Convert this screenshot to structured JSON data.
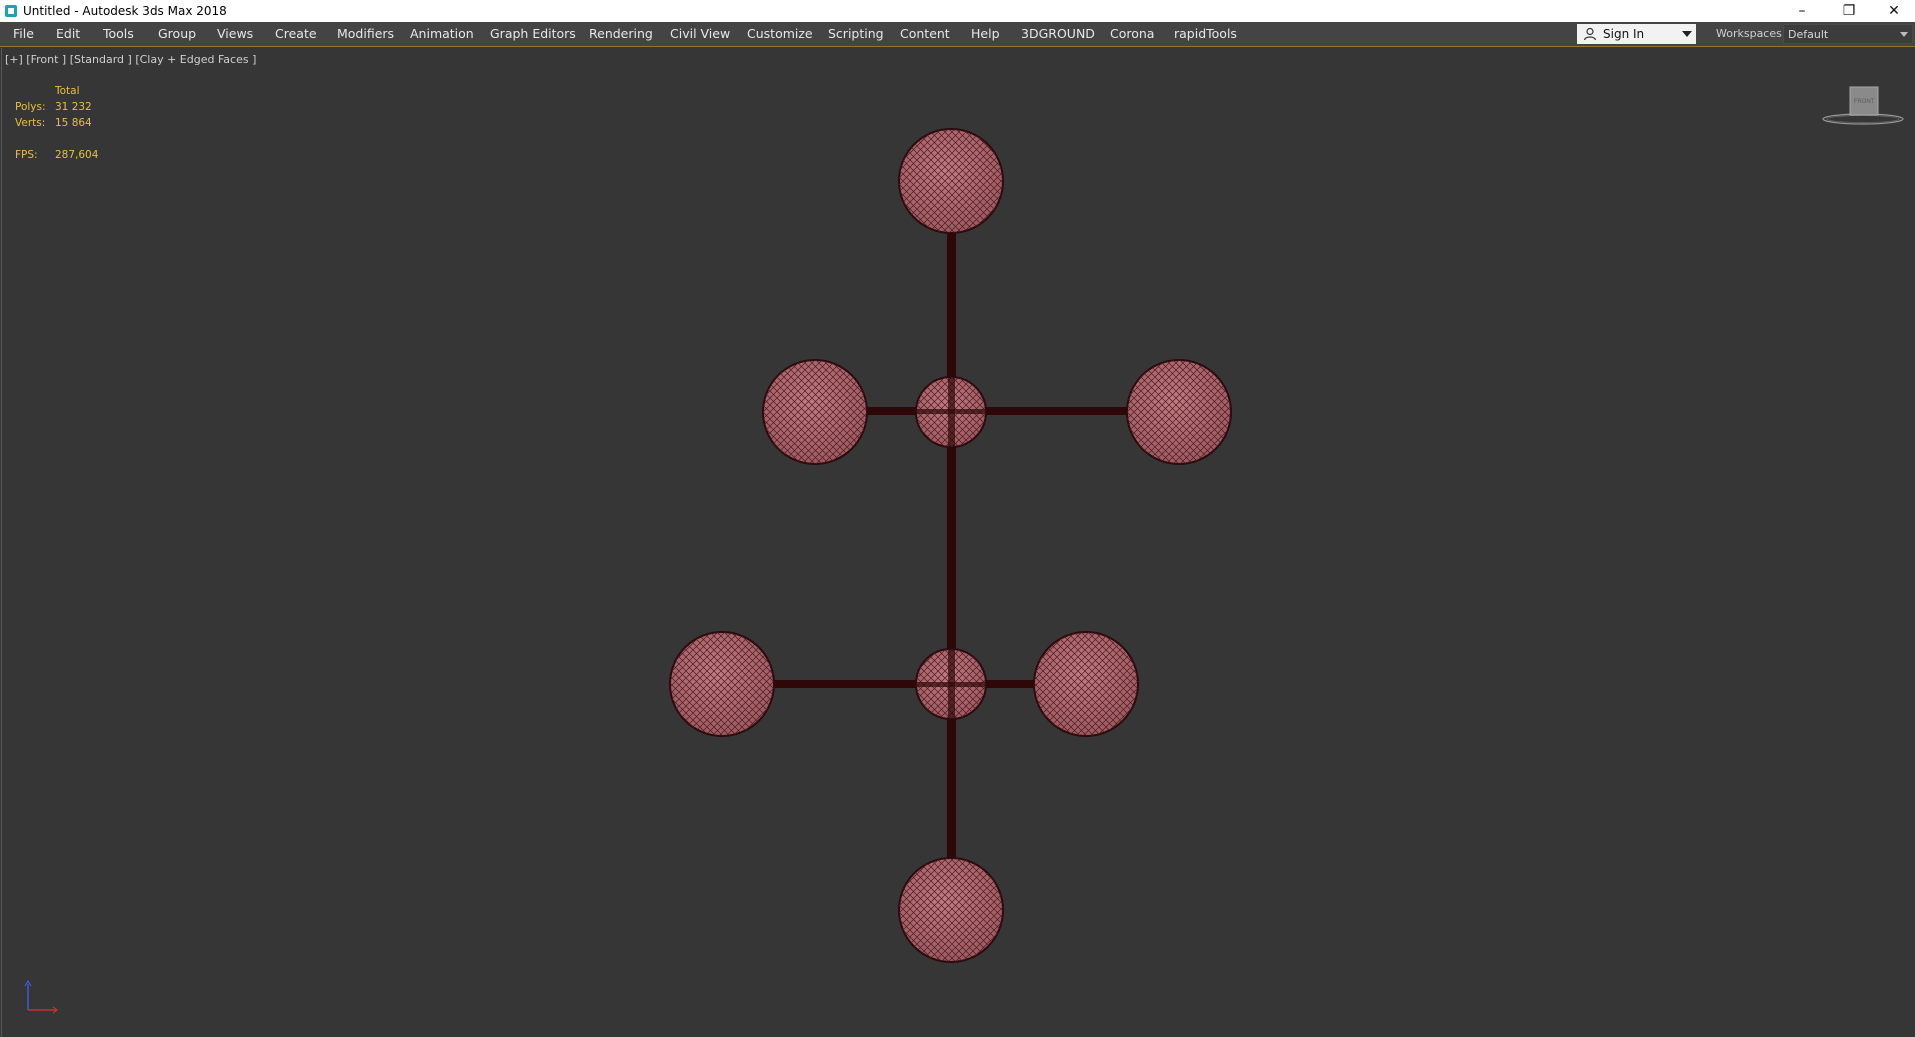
{
  "window": {
    "title": "Untitled - Autodesk 3ds Max 2018",
    "minimize_icon": "minimize-icon",
    "restore_icon": "restore-icon",
    "close_icon": "close-icon"
  },
  "menu": {
    "items": [
      {
        "label": "File"
      },
      {
        "label": "Edit"
      },
      {
        "label": "Tools"
      },
      {
        "label": "Group"
      },
      {
        "label": "Views"
      },
      {
        "label": "Create"
      },
      {
        "label": "Modifiers"
      },
      {
        "label": "Animation"
      },
      {
        "label": "Graph Editors"
      },
      {
        "label": "Rendering"
      },
      {
        "label": "Civil View"
      },
      {
        "label": "Customize"
      },
      {
        "label": "Scripting"
      },
      {
        "label": "Content"
      },
      {
        "label": "Help"
      },
      {
        "label": "3DGROUND"
      },
      {
        "label": "Corona"
      },
      {
        "label": "rapidTools"
      }
    ],
    "sign_in": "Sign In",
    "workspaces_label": "Workspaces:",
    "workspaces_value": "Default"
  },
  "viewport": {
    "label": "[+] [Front ] [Standard ] [Clay + Edged Faces ]",
    "stats": {
      "header": "Total",
      "polys_label": "Polys:",
      "polys_value": "31 232",
      "verts_label": "Verts:",
      "verts_value": "15 864",
      "fps_label": "FPS:",
      "fps_value": "287,604"
    },
    "viewcube_label": "FRONT"
  },
  "colors": {
    "sphere_fill": "#b76a70",
    "sphere_wire": "#3a1014",
    "rod": "#2e0808",
    "stats_text": "#e8c040"
  }
}
